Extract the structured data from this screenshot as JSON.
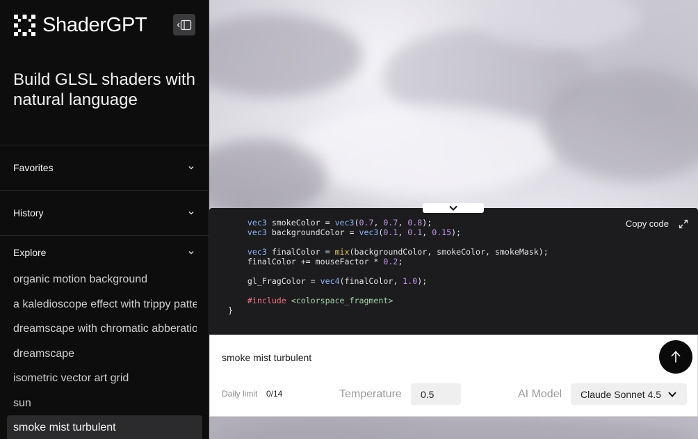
{
  "app": {
    "name": "ShaderGPT",
    "tagline": "Build GLSL shaders with natural language"
  },
  "sidebar": {
    "sections": {
      "favorites": "Favorites",
      "history": "History",
      "explore": "Explore"
    },
    "explore_items": [
      "organic motion background",
      "a kaledioscope effect with trippy patterns",
      "dreamscape with chromatic abberation",
      "dreamscape",
      "isometric vector art grid",
      "sun",
      "smoke mist turbulent"
    ],
    "active_item": "smoke mist turbulent"
  },
  "code_panel": {
    "copy_label": "Copy code"
  },
  "prompt": {
    "text": "smoke mist turbulent",
    "daily_limit_label": "Daily limit",
    "daily_limit_value": "0/14",
    "temperature_label": "Temperature",
    "temperature_value": "0.5",
    "model_label": "AI Model",
    "model_value": "Claude Sonnet 4.5"
  },
  "colors": {
    "sidebar_bg": "#0d0d0e",
    "code_bg": "#1c1c1e",
    "send_button": "#0a0a0a"
  },
  "icons": [
    "logo-icon",
    "sidebar-collapse-icon",
    "chevron-down-icon",
    "expand-icon",
    "arrow-up-icon"
  ]
}
